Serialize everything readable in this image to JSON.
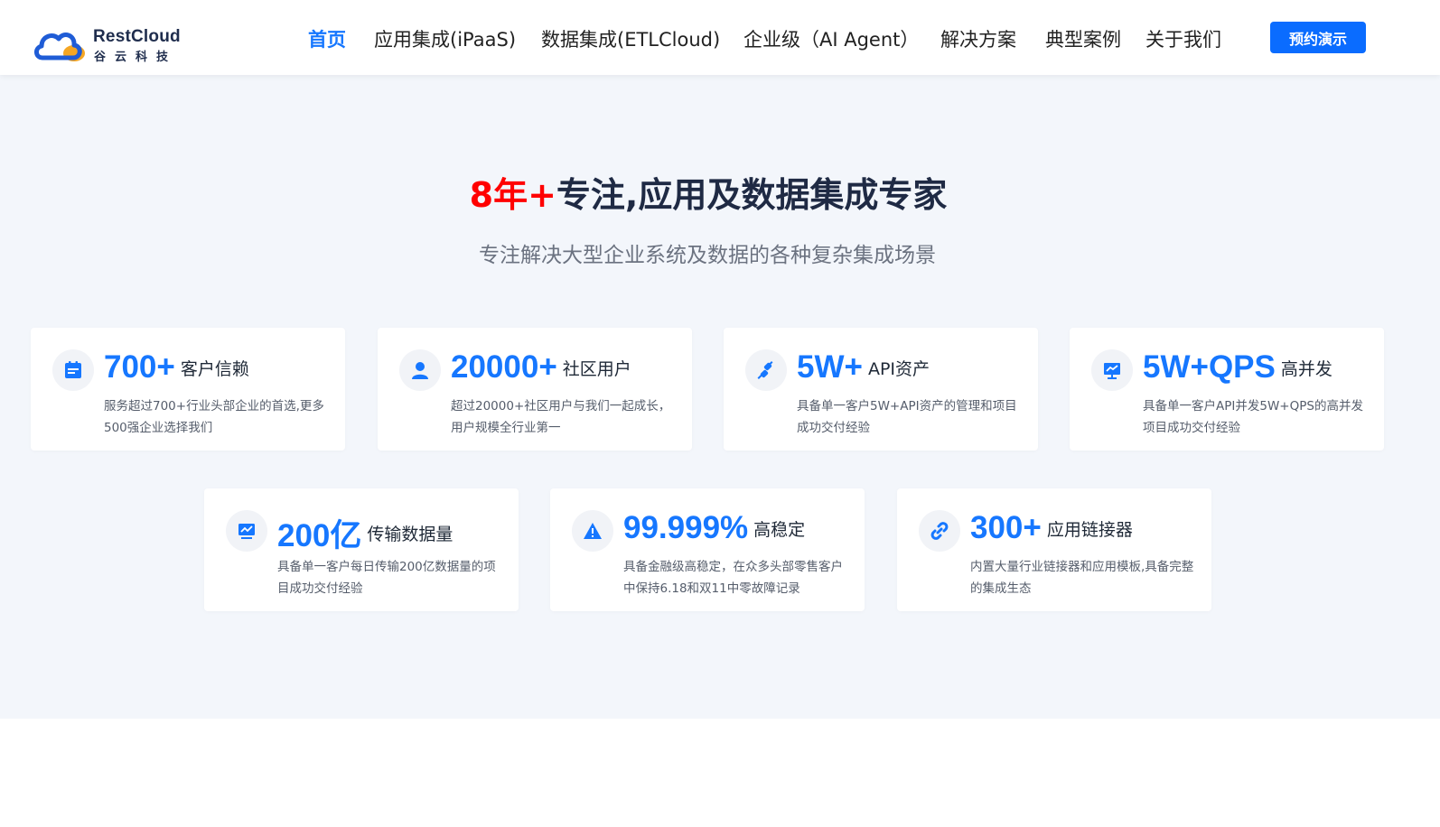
{
  "brand": {
    "name_en": "RestCloud",
    "name_cn": "谷云科技",
    "colors": {
      "primary": "#1677ff",
      "accent": "#ff0000",
      "cloud_orange": "#f5a623"
    }
  },
  "nav": {
    "items": [
      {
        "label": "首页",
        "active": true
      },
      {
        "label": "应用集成(iPaaS)",
        "active": false
      },
      {
        "label": "数据集成(ETLCloud)",
        "active": false
      },
      {
        "label": "企业级（AI Agent）",
        "active": false
      },
      {
        "label": "解决方案",
        "active": false
      },
      {
        "label": "典型案例",
        "active": false
      },
      {
        "label": "关于我们",
        "active": false
      }
    ],
    "cta_label": "预约演示"
  },
  "hero": {
    "headline_accent": "8年+",
    "headline_rest": "专注,应用及数据集成专家",
    "subheadline": "专注解决大型企业系统及数据的各种复杂集成场景"
  },
  "stats": [
    {
      "icon": "calendar-icon",
      "value": "700+",
      "label": "客户信赖",
      "desc": "服务超过700+行业头部企业的首选,更多500强企业选择我们"
    },
    {
      "icon": "user-icon",
      "value": "20000+",
      "label": "社区用户",
      "desc": "超过20000+社区用户与我们一起成长，用户规模全行业第一"
    },
    {
      "icon": "plug-icon",
      "value": "5W+",
      "label": "API资产",
      "desc": "具备单一客户5W+API资产的管理和项目成功交付经验"
    },
    {
      "icon": "presentation-icon",
      "value": "5W+QPS",
      "label": "高并发",
      "desc": "具备单一客户API并发5W+QPS的高并发项目成功交付经验"
    },
    {
      "icon": "monitor-chart-icon",
      "value": "200亿",
      "label": "传输数据量",
      "desc": "具备单一客户每日传输200亿数据量的项目成功交付经验"
    },
    {
      "icon": "warning-icon",
      "value": "99.999%",
      "label": "高稳定",
      "desc": "具备金融级高稳定，在众多头部零售客户中保持6.18和双11中零故障记录"
    },
    {
      "icon": "link-icon",
      "value": "300+",
      "label": "应用链接器",
      "desc": "内置大量行业链接器和应用模板,具备完整的集成生态"
    }
  ]
}
